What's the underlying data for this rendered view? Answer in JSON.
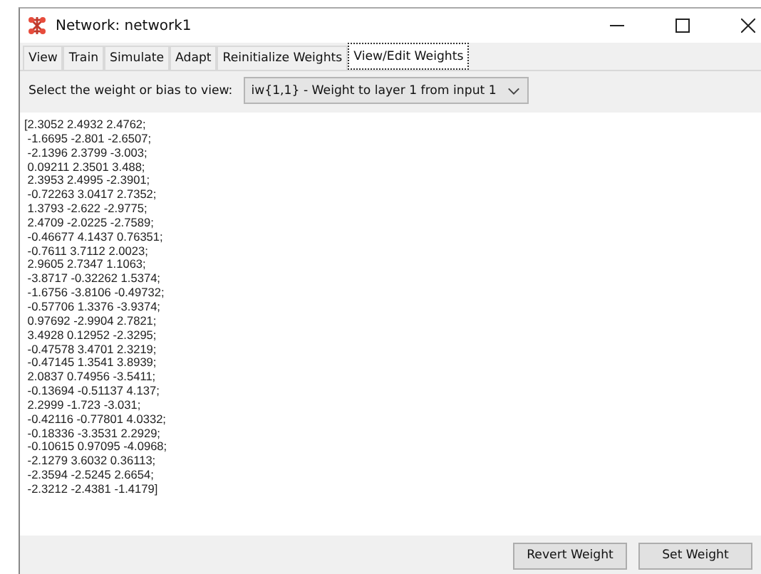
{
  "window": {
    "title": "Network: network1"
  },
  "tabs": [
    {
      "label": "View",
      "selected": false
    },
    {
      "label": "Train",
      "selected": false
    },
    {
      "label": "Simulate",
      "selected": false
    },
    {
      "label": "Adapt",
      "selected": false
    },
    {
      "label": "Reinitialize Weights",
      "selected": false
    },
    {
      "label": "View/Edit Weights",
      "selected": true
    }
  ],
  "selector": {
    "label": "Select the weight or bias to view:",
    "value": "iw{1,1} - Weight to layer 1 from input 1"
  },
  "weights_text": [
    "[2.3052 2.4932 2.4762;",
    " -1.6695 -2.801 -2.6507;",
    " -2.1396 2.3799 -3.003;",
    " 0.09211 2.3501 3.488;",
    " 2.3953 2.4995 -2.3901;",
    " -0.72263 3.0417 2.7352;",
    " 1.3793 -2.622 -2.9775;",
    " 2.4709 -2.0225 -2.7589;",
    " -0.46677 4.1437 0.76351;",
    " -0.7611 3.7112 2.0023;",
    " 2.9605 2.7347 1.1063;",
    " -3.8717 -0.32262 1.5374;",
    " -1.6756 -3.8106 -0.49732;",
    " -0.57706 1.3376 -3.9374;",
    " 0.97692 -2.9904 2.7821;",
    " 3.4928 0.12952 -2.3295;",
    " -0.47578 3.4701 2.3219;",
    " -0.47145 1.3541 3.8939;",
    " 2.0837 0.74956 -3.5411;",
    " -0.13694 -0.51137 4.137;",
    " 2.2999 -1.723 -3.031;",
    " -0.42116 -0.77801 4.0332;",
    " -0.18336 -3.3531 2.2929;",
    " -0.10615 0.97095 -4.0968;",
    " -2.1279 3.6032 0.36113;",
    " -2.3594 -2.5245 2.6654;",
    " -2.3212 -2.4381 -1.4179]"
  ],
  "buttons": [
    "Revert Weight",
    "Set Weight"
  ]
}
